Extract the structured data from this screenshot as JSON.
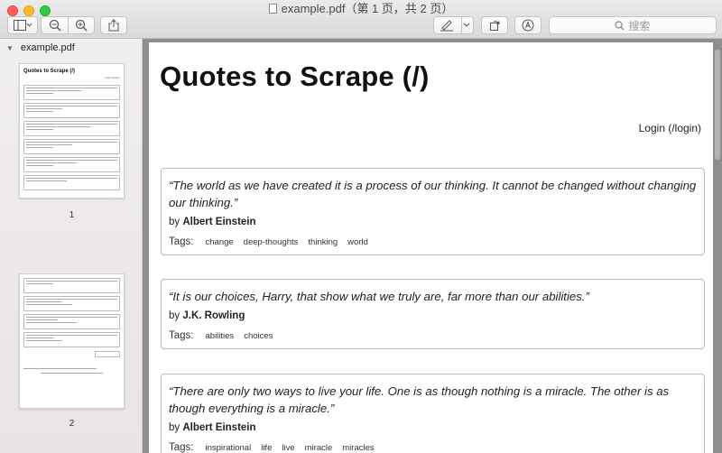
{
  "window": {
    "title": "example.pdf（第 1 页，共 2 页）",
    "search_placeholder": "搜索"
  },
  "sidebar": {
    "filename": "example.pdf",
    "pages": [
      {
        "number": "1",
        "thumb_title": "Quotes to Scrape (/)",
        "thumb_login": "Login (/login)"
      },
      {
        "number": "2"
      }
    ]
  },
  "document": {
    "title": "Quotes to Scrape (/)",
    "login": "Login (/login)",
    "tags_label": "Tags:",
    "by_label": "by",
    "quotes": [
      {
        "text": "“The world as we have created it is a process of our thinking. It cannot be changed without changing our thinking.”",
        "author": "Albert Einstein",
        "tags": [
          "change",
          "deep-thoughts",
          "thinking",
          "world"
        ]
      },
      {
        "text": "“It is our choices, Harry, that show what we truly are, far more than our abilities.”",
        "author": "J.K. Rowling",
        "tags": [
          "abilities",
          "choices"
        ]
      },
      {
        "text": "“There are only two ways to live your life. One is as though nothing is a miracle. The other is as though everything is a miracle.”",
        "author": "Albert Einstein",
        "tags": [
          "inspirational",
          "life",
          "live",
          "miracle",
          "miracles"
        ]
      }
    ]
  }
}
